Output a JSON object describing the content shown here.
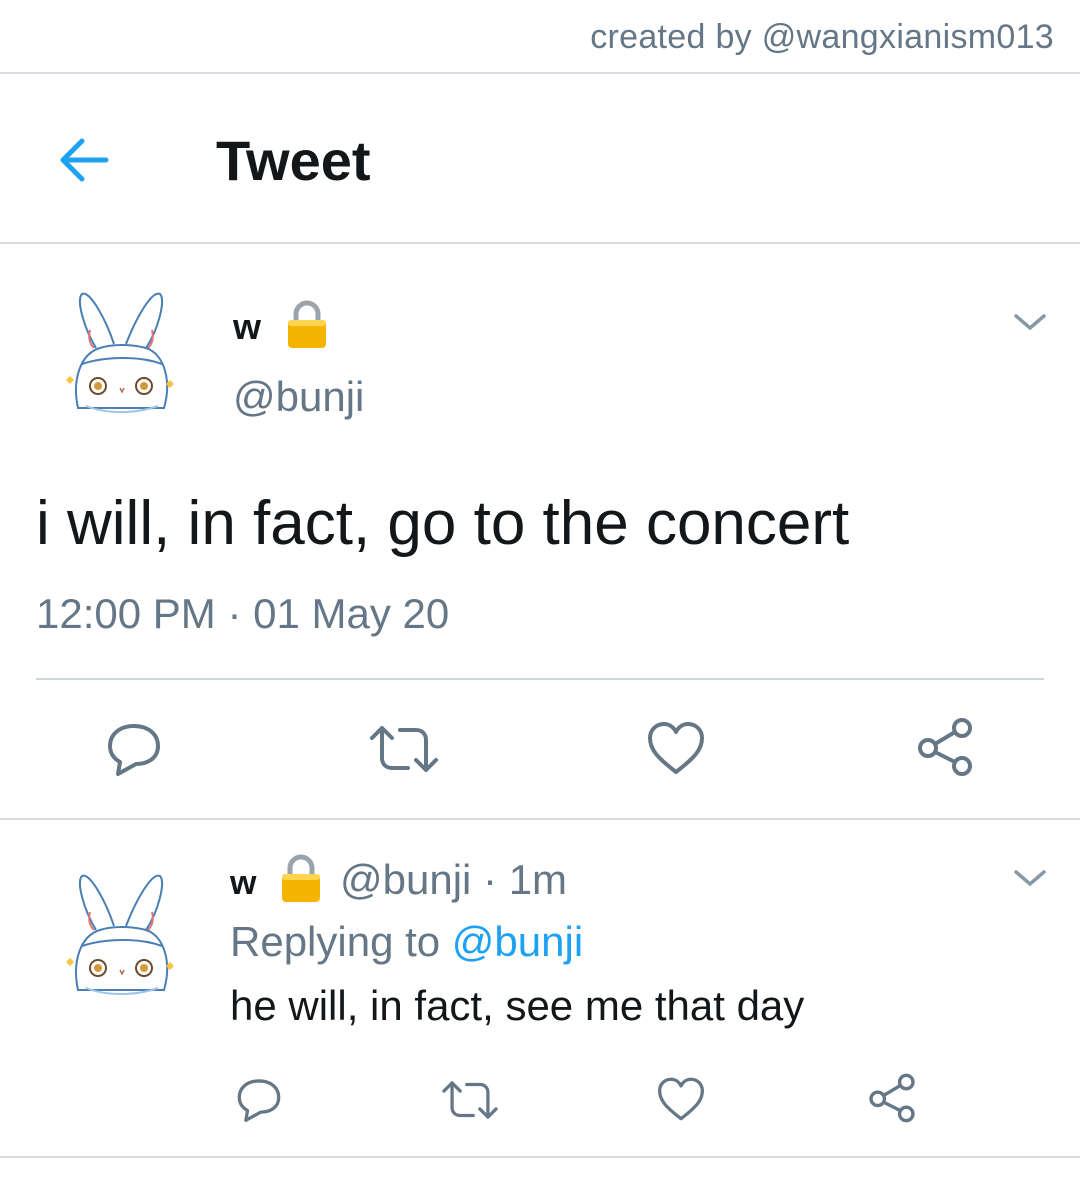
{
  "watermark": "created by @wangxianism013",
  "header": {
    "title": "Tweet",
    "back_icon": "arrow-left-icon",
    "accent": "#1da1f2"
  },
  "main_tweet": {
    "name": "w",
    "lock_icon": "lock-icon",
    "handle": "@bunji",
    "text": "i will, in fact, go to the concert",
    "timestamp": "12:00 PM · 01 May 20",
    "actions": [
      "reply-icon",
      "retweet-icon",
      "like-icon",
      "share-icon"
    ]
  },
  "reply_tweet": {
    "name": "w",
    "lock_icon": "lock-icon",
    "handle": "@bunji",
    "time": "· 1m",
    "replying_label": "Replying to",
    "replying_to": "@bunji",
    "text": "he will, in fact, see me that day",
    "actions": [
      "reply-icon",
      "retweet-icon",
      "like-icon",
      "share-icon"
    ]
  },
  "colors": {
    "text": "#14171a",
    "secondary": "#657786",
    "divider": "#d8dee3",
    "lock": "#f4b400"
  }
}
